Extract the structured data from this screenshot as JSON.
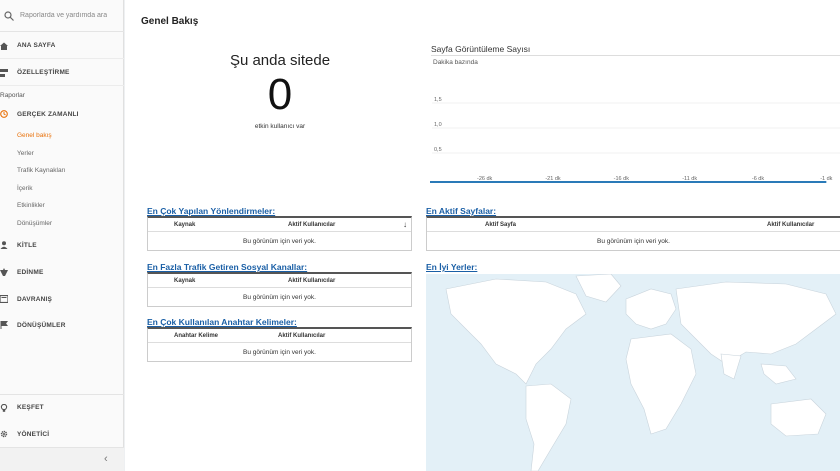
{
  "sidebar": {
    "search_placeholder": "Raporlarda ve yardımda ara",
    "home": "ANA SAYFA",
    "customize": "ÖZELLEŞTİRME",
    "reports_label": "Raporlar",
    "realtime": "GERÇEK ZAMANLI",
    "realtime_items": [
      "Genel bakış",
      "Yerler",
      "Trafik Kaynakları",
      "İçerik",
      "Etkinlikler",
      "Dönüşümler"
    ],
    "audience": "KİTLE",
    "acquisition": "EDİNME",
    "behavior": "DAVRANIŞ",
    "conversions": "DÖNÜŞÜMLER",
    "discover": "KEŞFET",
    "admin": "YÖNETİCİ"
  },
  "main": {
    "title": "Genel Bakış",
    "now_heading": "Şu anda sitede",
    "active_count": "0",
    "active_sub": "etkin kullanıcı var"
  },
  "pageviews": {
    "title": "Sayfa Görüntüleme Sayısı",
    "subtitle": "Dakika bazında"
  },
  "chart_data": {
    "type": "line",
    "title": "Sayfa Görüntüleme Sayısı",
    "subtitle": "Dakika bazında",
    "y_ticks": [
      "1,5",
      "1,0",
      "0,5"
    ],
    "x_ticks": [
      "-26 dk",
      "-21 dk",
      "-16 dk",
      "-11 dk",
      "-6 dk",
      "-1 dk"
    ],
    "x": [
      -30,
      -26,
      -21,
      -16,
      -11,
      -6,
      -1
    ],
    "values": [
      0,
      0,
      0,
      0,
      0,
      0,
      0
    ],
    "ylim": [
      0,
      2
    ]
  },
  "panels": {
    "referrals": {
      "title": "En Çok Yapılan Yönlendirmeler:",
      "col1": "Kaynak",
      "col2": "Aktif Kullanıcılar",
      "empty": "Bu görünüm için veri yok."
    },
    "social": {
      "title": "En Fazla Trafik Getiren Sosyal Kanallar:",
      "col1": "Kaynak",
      "col2": "Aktif Kullanıcılar",
      "empty": "Bu görünüm için veri yok."
    },
    "keywords": {
      "title": "En Çok Kullanılan Anahtar Kelimeler:",
      "col1": "Anahtar Kelime",
      "col2": "Aktif Kullanıcılar",
      "empty": "Bu görünüm için veri yok."
    },
    "pages": {
      "title": "En Aktif Sayfalar:",
      "col1": "Aktif Sayfa",
      "col2": "Aktif Kullanıcılar",
      "empty": "Bu görünüm için veri yok."
    },
    "locations": {
      "title": "En İyi Yerler:"
    }
  },
  "colors": {
    "accent": "#e8710a",
    "link": "#1a5fa6",
    "line": "#2a7ab8",
    "map_land": "#ffffff",
    "map_water": "#e3f0f7"
  }
}
